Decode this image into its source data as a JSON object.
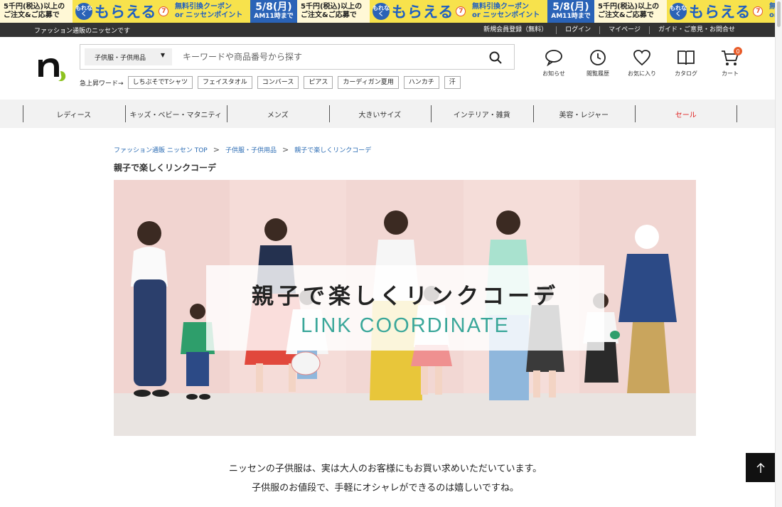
{
  "promo_banner": {
    "left_line1": "5千円(税込)以上の",
    "left_line2": "ご注文&ご応募で",
    "badge": "もれなく",
    "headline": "もらえる",
    "seven": "7",
    "coupon_line1": "無料引換クーポン",
    "coupon_or": "or",
    "coupon_line2": "ニッセンポイント",
    "deadline_date": "5/8(月)",
    "deadline_time": "AM11時まで"
  },
  "utility_bar": {
    "tagline": "ファッション通販のニッセンです",
    "links": [
      "新規会員登録（無料）",
      "ログイン",
      "マイページ",
      "ガイド・ご意見・お問合せ"
    ]
  },
  "header": {
    "search_category": "子供服・子供用品",
    "search_placeholder": "キーワードや商品番号から探す",
    "trend_label": "急上昇ワード→",
    "trend_words": [
      "しちぶそでTシャツ",
      "フェイスタオル",
      "コンバース",
      "ピアス",
      "カーディガン夏用",
      "ハンカチ",
      "汗"
    ],
    "icons": [
      {
        "name": "notice",
        "label": "お知らせ"
      },
      {
        "name": "history",
        "label": "閲覧履歴"
      },
      {
        "name": "favorite",
        "label": "お気に入り"
      },
      {
        "name": "catalog",
        "label": "カタログ"
      },
      {
        "name": "cart",
        "label": "カート"
      }
    ],
    "cart_count": "0"
  },
  "category_nav": [
    "レディース",
    "キッズ・ベビー・マタニティ",
    "メンズ",
    "大きいサイズ",
    "インテリア・雑貨",
    "美容・レジャー",
    "セール"
  ],
  "breadcrumb": [
    "ファッション通販 ニッセン TOP",
    "子供服・子供用品",
    "親子で楽しくリンクコーデ"
  ],
  "breadcrumb_separator": ">",
  "page_title": "親子で楽しくリンクコーデ",
  "hero": {
    "title_jp": "親子で楽しくリンクコーデ",
    "title_en": "LINK COORDINATE"
  },
  "intro": {
    "line1": "ニッセンの子供服は、実は大人のお客様にもお買い求めいただいています。",
    "line2": "子供服のお値段で、手軽にオシャレができるのは嬉しいですね。"
  },
  "colors": {
    "brand_green": "#8dc21f",
    "sale_red": "#e02020",
    "link_blue": "#2a6bb3",
    "accent_teal": "#3aa79a"
  }
}
